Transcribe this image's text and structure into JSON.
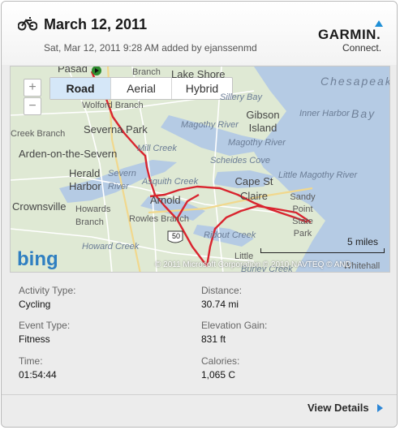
{
  "header": {
    "title": "March 12, 2011",
    "subtitle": "Sat, Mar 12, 2011 9:28 AM added by ejanssenmd",
    "activity_icon": "bicycle-icon",
    "logo_word": "GARMIN.",
    "logo_sub": "Connect."
  },
  "map": {
    "tabs": [
      "Road",
      "Aerial",
      "Hybrid"
    ],
    "active_tab": "Road",
    "zoom_in_icon": "plus-icon",
    "zoom_out_icon": "minus-icon",
    "place_labels": [
      "Pasad",
      "Branch",
      "Lake Shore",
      "Chesapeake",
      "Wolford Branch",
      "Sillery Bay",
      "Gibson Island",
      "Inner Harbor",
      "Bay",
      "Severna Park",
      "Magothy River",
      "Creek Branch",
      "Mill Creek",
      "Magothy River",
      "Arden-on-the-Severn",
      "Scheides Cove",
      "Herald Harbor",
      "Severn River",
      "Asquith Creek",
      "Little Magothy River",
      "Cape St Claire",
      "Sandy Point State Park",
      "Crownsville",
      "Howards Branch",
      "Arnold",
      "Rowles Branch",
      "Ridout Creek",
      "Howard Creek",
      "Little",
      "Burley Creek",
      "Whitehall"
    ],
    "route_shield": "50",
    "scale_label": "5 miles",
    "bing_logo": "bing",
    "copyright": "© 2011 Microsoft Corporation   © 2010 NAVTEQ   © AND",
    "route_color": "#d9252f"
  },
  "stats": [
    {
      "label": "Activity Type:",
      "value": "Cycling"
    },
    {
      "label": "Distance:",
      "value": "30.74 mi"
    },
    {
      "label": "Event Type:",
      "value": "Fitness"
    },
    {
      "label": "Elevation Gain:",
      "value": "831 ft"
    },
    {
      "label": "Time:",
      "value": "01:54:44"
    },
    {
      "label": "Calories:",
      "value": "1,065 C"
    }
  ],
  "footer": {
    "view_details": "View Details"
  }
}
